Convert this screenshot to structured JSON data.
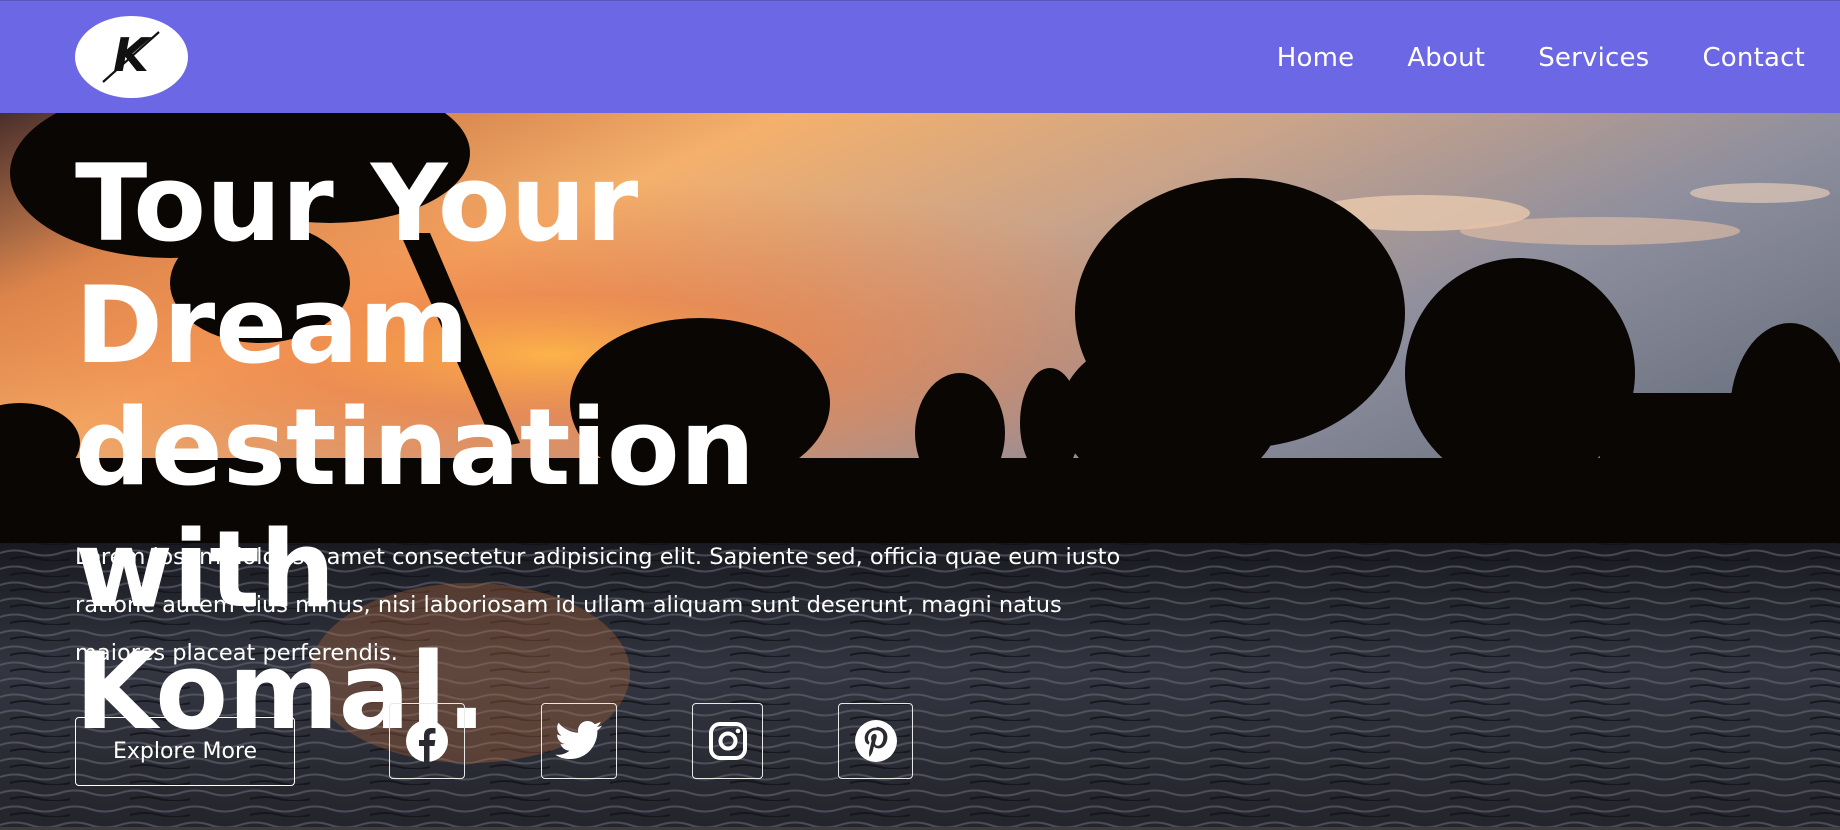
{
  "header": {
    "logo_letter": "K",
    "nav": [
      "Home",
      "About",
      "Services",
      "Contact"
    ]
  },
  "hero": {
    "title_line1": "Tour Your Dream",
    "title_line2": "destination with",
    "title_line3": "Komal.",
    "text": "Lorem ipsum dolor sit amet consectetur adipisicing elit. Sapiente sed, officia quae eum iusto ratione autem eius minus, nisi laboriosam id ullam aliquam sunt deserunt, magni natus maiores placeat perferendis.",
    "button_label": "Explore More",
    "social_icons": [
      "facebook-icon",
      "twitter-icon",
      "instagram-icon",
      "pinterest-icon"
    ]
  },
  "colors": {
    "navbar": "#6c67e4",
    "text": "#ffffff"
  }
}
